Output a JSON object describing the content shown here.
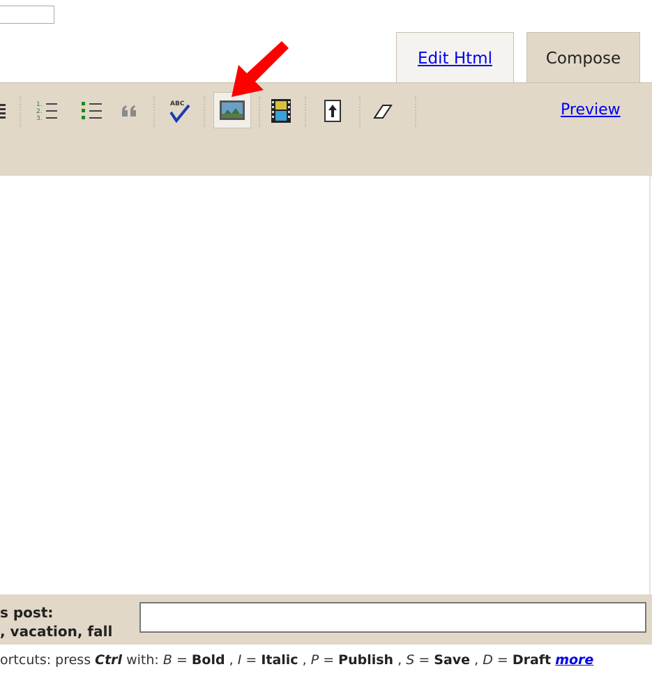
{
  "tabs": {
    "edit_html": "Edit Html",
    "compose": "Compose"
  },
  "toolbar": {
    "preview_label": "Preview",
    "icons": [
      "align-icon",
      "numbered-list-icon",
      "bullet-list-icon",
      "blockquote-icon",
      "spellcheck-icon",
      "add-image-icon",
      "add-video-icon",
      "insert-jump-break-icon",
      "remove-formatting-icon"
    ],
    "spellcheck_text": "ABC"
  },
  "labels": {
    "heading": "s post:",
    "example": ", vacation, fall",
    "input_value": ""
  },
  "shortcuts": {
    "intro": "ortcuts: press ",
    "ctrl": "Ctrl",
    "with": " with: ",
    "b_key": "B",
    "b_label": "Bold",
    "i_key": "I",
    "i_label": "Italic",
    "p_key": "P",
    "p_label": "Publish",
    "s_key": "S",
    "s_label": "Save",
    "d_key": "D",
    "d_label": "Draft",
    "more": "more"
  },
  "colors": {
    "toolbar_bg": "#e2d8c8",
    "link": "#0000ee",
    "arrow": "#ff0000"
  }
}
